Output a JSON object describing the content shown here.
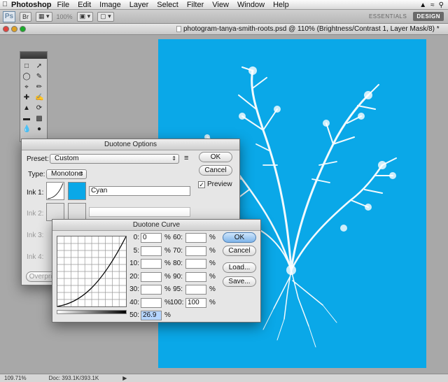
{
  "menubar": {
    "app_name": "Photoshop",
    "items": [
      "File",
      "Edit",
      "Image",
      "Layer",
      "Select",
      "Filter",
      "View",
      "Window",
      "Help"
    ]
  },
  "appbar": {
    "logo": "Ps",
    "zoom": "100%",
    "workspaces": {
      "essentials": "ESSENTIALS",
      "design": "DESIGN"
    }
  },
  "document": {
    "title": "photogram-tanya-smith-roots.psd @ 110% (Brightness/Contrast 1, Layer Mask/8) *",
    "canvas_color": "#0aa8e8"
  },
  "status": {
    "zoom": "109.71%",
    "doc": "Doc: 393.1K/393.1K"
  },
  "duotone_options": {
    "title": "Duotone Options",
    "preset_label": "Preset:",
    "preset_value": "Custom",
    "type_label": "Type:",
    "type_value": "Monotone",
    "ink1_label": "Ink 1:",
    "ink1_name": "Cyan",
    "ink1_color": "#0aa8e8",
    "ink2_label": "Ink 2:",
    "ink3_label": "Ink 3:",
    "ink4_label": "Ink 4:",
    "overprint_label": "Overpri",
    "ok": "OK",
    "cancel": "Cancel",
    "preview_label": "Preview",
    "preview_checked": true
  },
  "duotone_curve": {
    "title": "Duotone Curve",
    "ok": "OK",
    "cancel": "Cancel",
    "load": "Load...",
    "save": "Save...",
    "pct": "%",
    "left": [
      {
        "label": "0:",
        "value": "0"
      },
      {
        "label": "5:",
        "value": ""
      },
      {
        "label": "10:",
        "value": ""
      },
      {
        "label": "20:",
        "value": ""
      },
      {
        "label": "30:",
        "value": ""
      },
      {
        "label": "40:",
        "value": ""
      },
      {
        "label": "50:",
        "value": "26.9"
      }
    ],
    "right": [
      {
        "label": "60:",
        "value": ""
      },
      {
        "label": "70:",
        "value": ""
      },
      {
        "label": "80:",
        "value": ""
      },
      {
        "label": "90:",
        "value": ""
      },
      {
        "label": "95:",
        "value": ""
      },
      {
        "label": "100:",
        "value": "100"
      }
    ]
  }
}
